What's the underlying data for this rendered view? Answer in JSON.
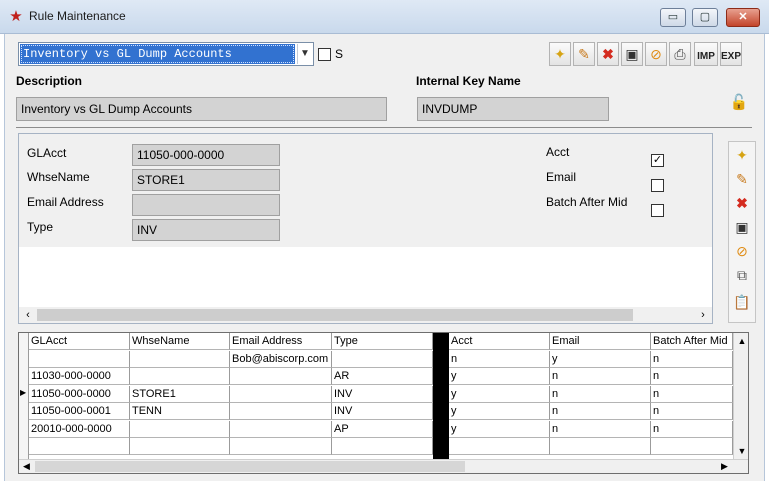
{
  "window": {
    "title": "Rule Maintenance",
    "app_icon": "star-icon",
    "min_glyph": "▭",
    "max_glyph": "▢",
    "close_glyph": "✕"
  },
  "top": {
    "rule_select_value": "Inventory vs GL Dump Accounts",
    "s_checkbox_label": "S",
    "description_label": "Description",
    "description_value": "Inventory vs GL Dump Accounts",
    "internal_key_label": "Internal Key Name",
    "internal_key_value": "INVDUMP"
  },
  "toolbar": {
    "imp_label": "IMP",
    "exp_label": "EXP"
  },
  "detail": {
    "fields": [
      {
        "label": "GLAcct",
        "value": "11050-000-0000"
      },
      {
        "label": "WhseName",
        "value": "STORE1"
      },
      {
        "label": "Email Address",
        "value": ""
      },
      {
        "label": "Type",
        "value": "INV"
      }
    ],
    "checks": [
      {
        "label": "Acct",
        "checked": true,
        "mark": "✓"
      },
      {
        "label": "Email",
        "checked": false,
        "mark": ""
      },
      {
        "label": "Batch After Mid",
        "checked": false,
        "mark": ""
      }
    ]
  },
  "grid": {
    "columns": [
      "GLAcct",
      "WhseName",
      "Email Address",
      "Type",
      "Acct",
      "Email",
      "Batch After Mid"
    ],
    "rows": [
      [
        "",
        "",
        "Bob@abiscorp.com",
        "",
        "n",
        "y",
        "n"
      ],
      [
        "11030-000-0000",
        "",
        "",
        "AR",
        "y",
        "n",
        "n"
      ],
      [
        "11050-000-0000",
        "STORE1",
        "",
        "INV",
        "y",
        "n",
        "n"
      ],
      [
        "11050-000-0001",
        "TENN",
        "",
        "INV",
        "y",
        "n",
        "n"
      ],
      [
        "20010-000-0000",
        "",
        "",
        "AP",
        "y",
        "n",
        "n"
      ]
    ],
    "current_row_marker": "▶"
  }
}
